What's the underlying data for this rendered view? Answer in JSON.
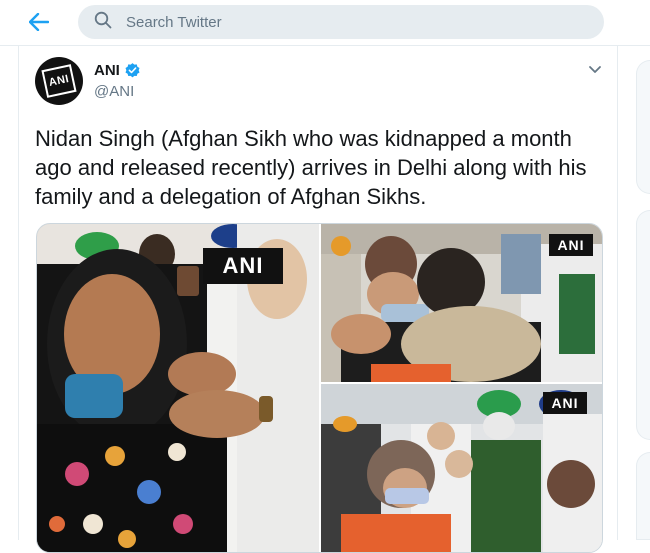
{
  "search": {
    "placeholder": "Search Twitter"
  },
  "tweet": {
    "author_name": "ANI",
    "author_handle": "@ANI",
    "avatar_text": "ANI",
    "text": "Nidan Singh (Afghan Sikh who was kidnapped a month ago and released recently) arrives in Delhi along with his family and a delegation of Afghan Sikhs."
  },
  "media": {
    "watermark": "ANI"
  },
  "colors": {
    "accent": "#1da1f2",
    "text": "#14171a",
    "muted": "#657786"
  },
  "icons": {
    "back": "back-arrow-icon",
    "search": "search-icon",
    "verified": "verified-badge-icon",
    "menu": "chevron-down-icon"
  }
}
